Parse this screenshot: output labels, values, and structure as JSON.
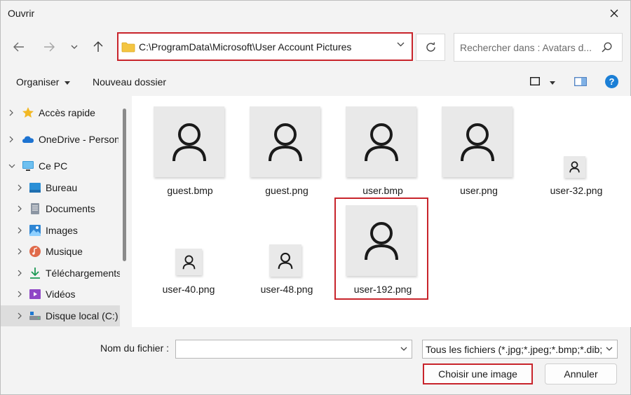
{
  "window": {
    "title": "Ouvrir"
  },
  "address": {
    "path": "C:\\ProgramData\\Microsoft\\User Account Pictures"
  },
  "search": {
    "placeholder": "Rechercher dans : Avatars d..."
  },
  "toolbar": {
    "organize_label": "Organiser",
    "new_folder_label": "Nouveau dossier"
  },
  "sidebar": {
    "items": [
      {
        "label": "Accès rapide",
        "icon": "star-icon"
      },
      {
        "label": "OneDrive - Person",
        "icon": "cloud-icon"
      },
      {
        "label": "Ce PC",
        "icon": "computer-icon"
      },
      {
        "label": "Bureau",
        "icon": "desktop-icon"
      },
      {
        "label": "Documents",
        "icon": "document-icon"
      },
      {
        "label": "Images",
        "icon": "images-icon"
      },
      {
        "label": "Musique",
        "icon": "music-icon"
      },
      {
        "label": "Téléchargements",
        "icon": "download-icon"
      },
      {
        "label": "Vidéos",
        "icon": "videos-icon"
      },
      {
        "label": "Disque local (C:)",
        "icon": "drive-icon"
      }
    ]
  },
  "files": [
    {
      "name": "guest.bmp",
      "icon": "user-avatar-icon"
    },
    {
      "name": "guest.png",
      "icon": "user-avatar-icon"
    },
    {
      "name": "user.bmp",
      "icon": "user-avatar-icon"
    },
    {
      "name": "user.png",
      "icon": "user-avatar-icon"
    },
    {
      "name": "user-32.png",
      "icon": "user-avatar-icon"
    },
    {
      "name": "user-40.png",
      "icon": "user-avatar-icon"
    },
    {
      "name": "user-48.png",
      "icon": "user-avatar-icon"
    },
    {
      "name": "user-192.png",
      "icon": "user-avatar-icon"
    }
  ],
  "footer": {
    "filename_label": "Nom du fichier :",
    "filename_value": "",
    "filter_value": "Tous les fichiers (*.jpg;*.jpeg;*.bmp;*.dib;",
    "open_label": "Choisir une image",
    "cancel_label": "Annuler"
  },
  "colors": {
    "highlight": "#c8242b",
    "folder": "#f4c542",
    "help": "#1b7fd6"
  }
}
